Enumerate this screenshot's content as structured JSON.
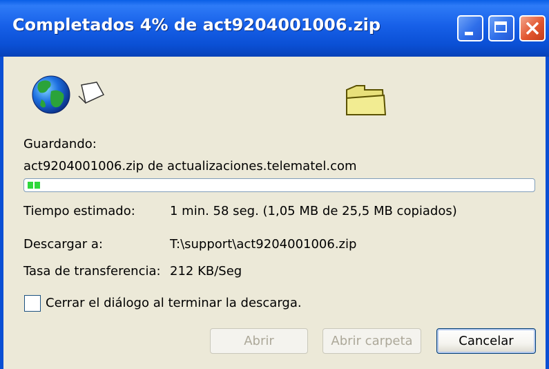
{
  "window": {
    "title": "Completados 4% de act9204001006.zip"
  },
  "icons": {
    "globe": "globe-icon",
    "document": "document-icon",
    "folder": "folder-icon"
  },
  "download": {
    "saving_label": "Guardando:",
    "source_line": "act9204001006.zip de actualizaciones.telematel.com",
    "progress_percent": 4,
    "estimated_label": "Tiempo estimado:",
    "estimated_value": "1 min. 58 seg. (1,05 MB de 25,5 MB copiados)",
    "destination_label": "Descargar a:",
    "destination_value": "T:\\support\\act9204001006.zip",
    "rate_label": "Tasa de transferencia:",
    "rate_value": "212 KB/Seg"
  },
  "options": {
    "close_on_finish_label": "Cerrar el diálogo al terminar la descarga.",
    "close_on_finish_checked": false
  },
  "buttons": {
    "open": "Abrir",
    "open_folder": "Abrir carpeta",
    "cancel": "Cancelar"
  },
  "colors": {
    "title_bar": "#0A4FD4",
    "progress_fill": "#2FD83B",
    "dialog_bg": "#ECE9D8"
  }
}
